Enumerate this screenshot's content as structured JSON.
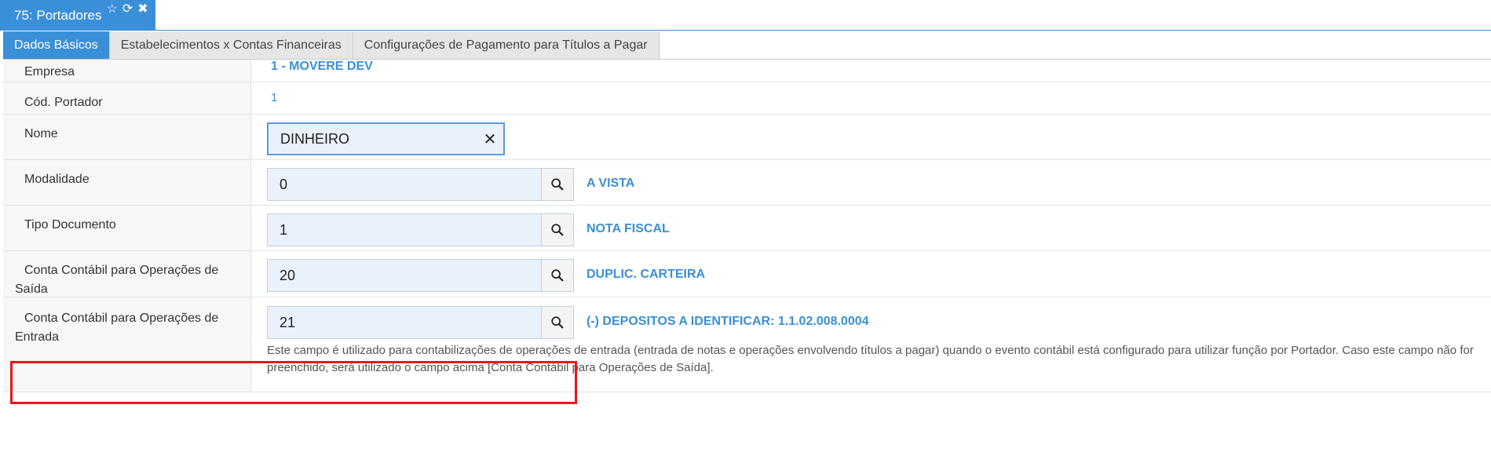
{
  "window": {
    "title": "75: Portadores",
    "icons": [
      "star-icon",
      "refresh-icon",
      "close-icon"
    ],
    "accent_color": "#3b8fd8"
  },
  "tabs": [
    {
      "label": "Dados Básicos",
      "active": true
    },
    {
      "label": "Estabelecimentos x Contas Financeiras",
      "active": false
    },
    {
      "label": "Configurações de Pagamento para Títulos a Pagar",
      "active": false
    }
  ],
  "form": {
    "empresa": {
      "label": "Empresa",
      "value": "1 - MOVERE DEV"
    },
    "cod_portador": {
      "label": "Cód. Portador",
      "value": "1"
    },
    "nome": {
      "label": "Nome",
      "value": "DINHEIRO"
    },
    "modalidade": {
      "label": "Modalidade",
      "value": "0",
      "description": "A VISTA"
    },
    "tipo_documento": {
      "label": "Tipo Documento",
      "value": "1",
      "description": "NOTA FISCAL"
    },
    "conta_saida": {
      "label": "Conta Contábil para Operações de Saída",
      "value": "20",
      "description": "DUPLIC. CARTEIRA"
    },
    "conta_entrada": {
      "label": "Conta Contábil para Operações de Entrada",
      "value": "21",
      "description": "(-) DEPOSITOS A IDENTIFICAR: 1.1.02.008.0004",
      "help": "Este campo é utilizado para contabilizações de operações de entrada (entrada de notas e operações envolvendo títulos a pagar) quando o evento contábil está configurado para utilizar função por Portador. Caso este campo não for preenchido, será utilizado o campo acima [Conta Contábil para Operações de Saída]."
    }
  },
  "highlight_color": "#e8171c"
}
